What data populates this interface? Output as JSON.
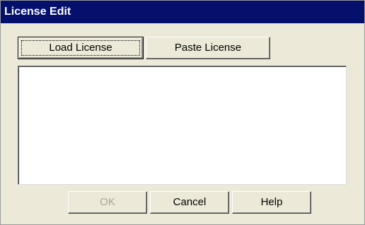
{
  "dialog": {
    "title": "License Edit"
  },
  "toolbar": {
    "load_license_label": "Load License",
    "paste_license_label": "Paste License"
  },
  "license_text": {
    "value": ""
  },
  "footer": {
    "ok_label": "OK",
    "cancel_label": "Cancel",
    "help_label": "Help"
  },
  "colors": {
    "title_bar": "#04106c",
    "dialog_bg": "#ece9d8",
    "disabled_text": "#a6a49a"
  }
}
